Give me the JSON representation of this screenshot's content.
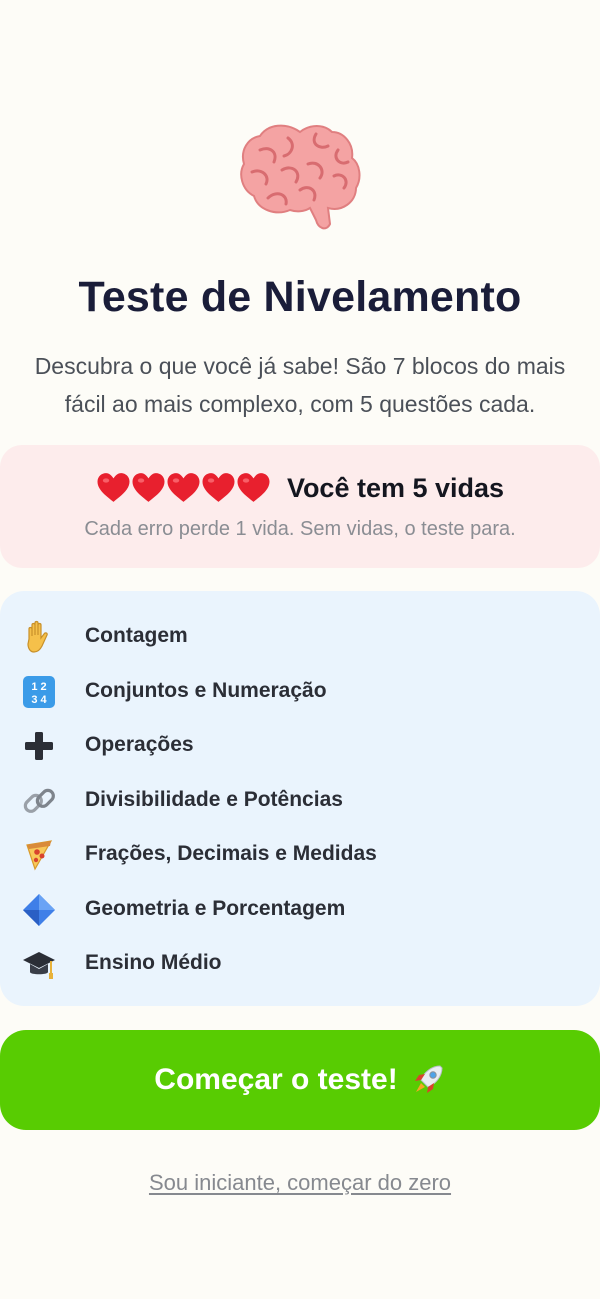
{
  "hero": {
    "icon": "brain-icon",
    "title": "Teste de Nivelamento",
    "subtitle_line1": "Descubra o que você já sabe! São 7 blocos do mais",
    "subtitle_line2": "fácil ao mais complexo, com 5 questões cada."
  },
  "lives": {
    "count": 5,
    "heart_icon": "heart-icon",
    "title": "Você tem 5 vidas",
    "description": "Cada erro perde 1 vida. Sem vidas, o teste para."
  },
  "topics": [
    {
      "icon": "raised-hand-icon",
      "label": "Contagem"
    },
    {
      "icon": "numbers-1234-icon",
      "label": "Conjuntos e Numeração"
    },
    {
      "icon": "plus-icon",
      "label": "Operações"
    },
    {
      "icon": "link-chain-icon",
      "label": "Divisibilidade e Potências"
    },
    {
      "icon": "pizza-icon",
      "label": "Frações, Decimais e Medidas"
    },
    {
      "icon": "blue-diamond-icon",
      "label": "Geometria e Porcentagem"
    },
    {
      "icon": "graduation-cap-icon",
      "label": "Ensino Médio"
    }
  ],
  "cta": {
    "label": "Começar o teste!",
    "icon": "rocket-icon"
  },
  "secondary_link": {
    "label": "Sou iniciante, começar do zero"
  },
  "colors": {
    "background": "#fdfcf7",
    "lives_card": "#fdecec",
    "topics_card": "#eaf4fd",
    "cta": "#58cc02",
    "heart": "#e8202e"
  }
}
